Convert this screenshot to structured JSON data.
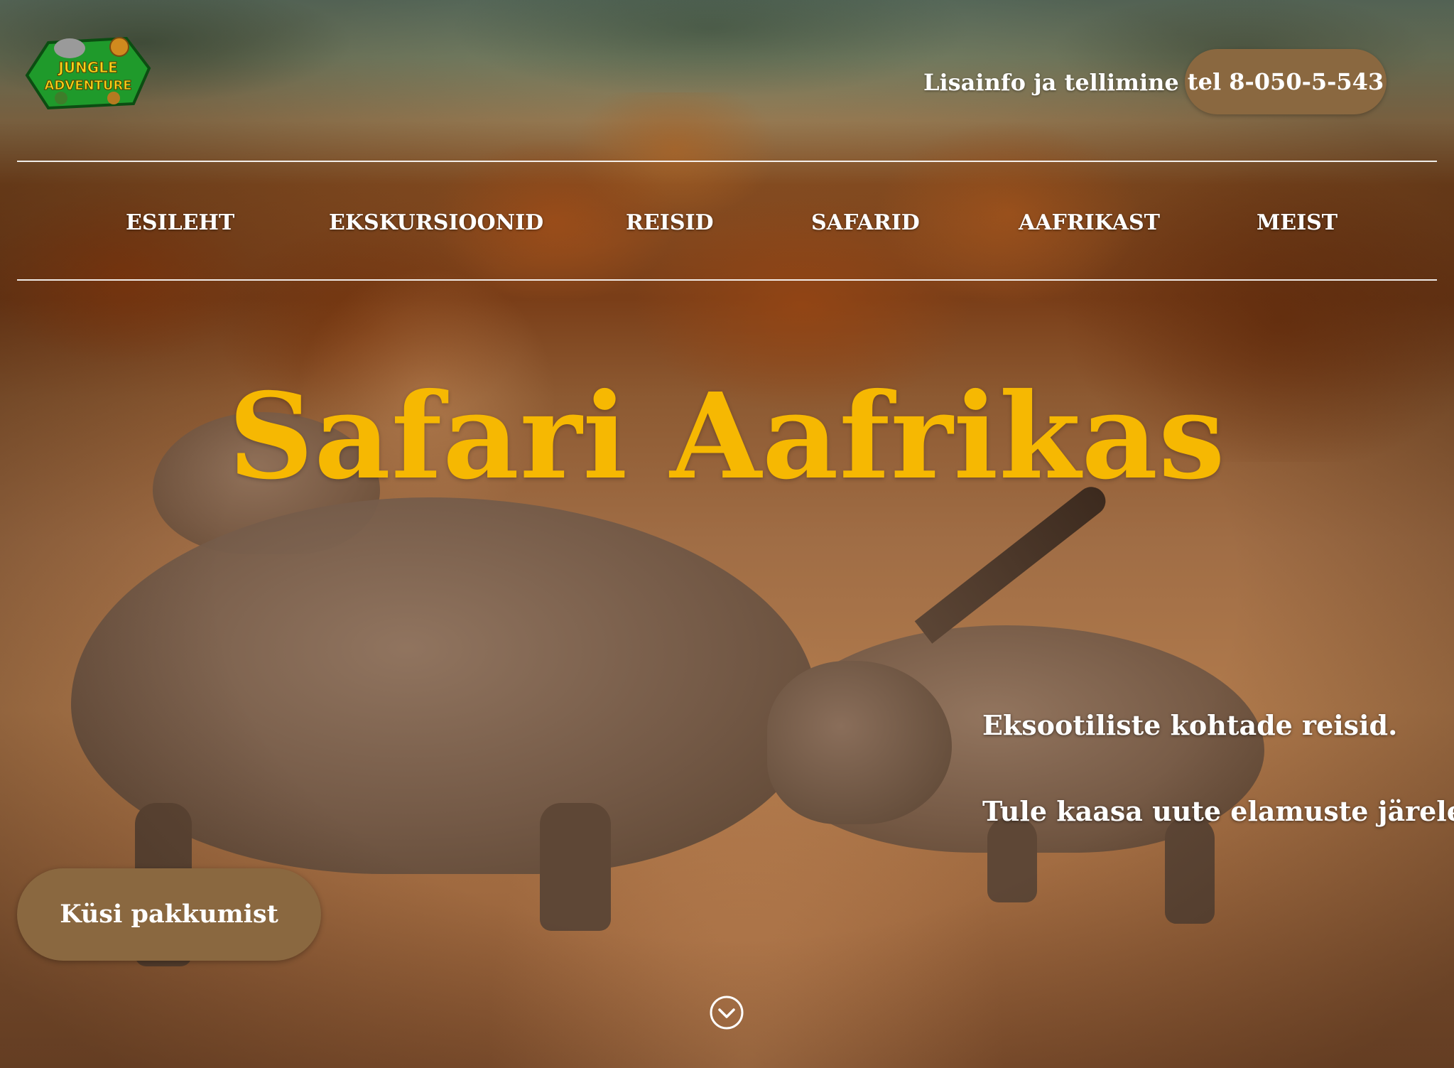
{
  "header": {
    "logo_line1": "JUNGLE",
    "logo_line2": "ADVENTURE",
    "info_link": "Lisainfo ja tellimine",
    "phone_button": "tel 8-050-5-543"
  },
  "nav": {
    "items": [
      {
        "label": "ESILEHT"
      },
      {
        "label": "EKSKURSIOONID"
      },
      {
        "label": "REISID"
      },
      {
        "label": "SAFARID"
      },
      {
        "label": "AAFRIKAST"
      },
      {
        "label": "MEIST"
      }
    ]
  },
  "hero": {
    "title": "Safari Aafrikas",
    "tagline1": "Eksootiliste kohtade reisid.",
    "tagline2": "Tule kaasa uute elamuste järele!",
    "cta_button": "Küsi pakkumist",
    "scroll_icon": "chevron-down-circle-icon"
  },
  "colors": {
    "accent_brown": "#8a6840",
    "title_yellow": "#f6b802",
    "logo_green": "#1f9a2b"
  }
}
